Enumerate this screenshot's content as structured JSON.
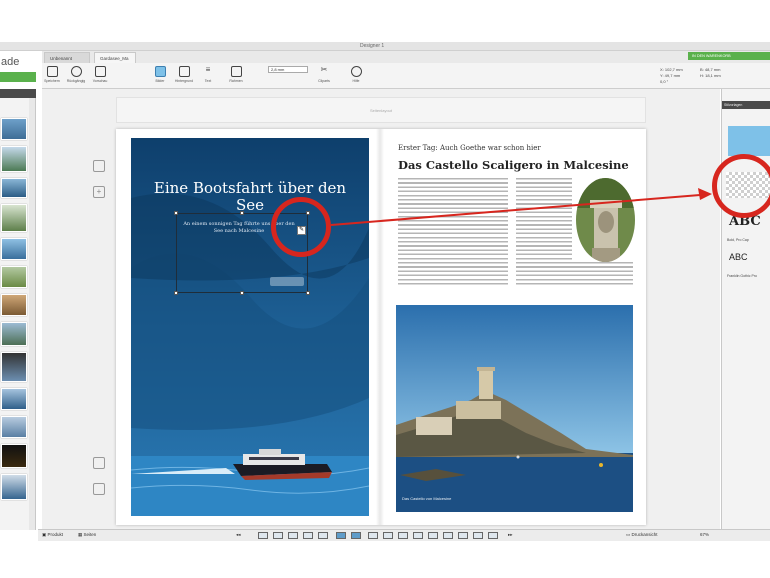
{
  "window": {
    "title": "Designer 1"
  },
  "logo": {
    "text": "ade"
  },
  "tabs": [
    {
      "label": "Unbenannt"
    },
    {
      "label": "Gardasee_Ma"
    }
  ],
  "toolbar": {
    "tools": [
      {
        "label": "Speichern",
        "icon": "save-icon"
      },
      {
        "label": "Rückgängig",
        "icon": "undo-icon"
      },
      {
        "label": "Vorschau",
        "icon": "preview-icon"
      },
      {
        "label": "Bilder",
        "icon": "image-icon"
      },
      {
        "label": "Hintergrund",
        "icon": "background-icon"
      },
      {
        "label": "Text",
        "icon": "text-icon"
      },
      {
        "label": "Rahmen",
        "icon": "frame-icon"
      },
      {
        "label": "Cliparts",
        "icon": "clipart-icon"
      },
      {
        "label": "Hilfe",
        "icon": "help-icon"
      }
    ],
    "font_size": "2,8 mm"
  },
  "coordinates": {
    "x": "X: 102,7 mm",
    "y": "Y: 49,7 mm",
    "w": "B: 48,7 mm",
    "h": "H: 18,1 mm",
    "angle": "0,0 °"
  },
  "order_button": "IN DEN WARENKORB",
  "layout_bar": "Seitenlayout",
  "left_page": {
    "headline": "Eine Bootsfahrt über den See",
    "subtitle": "An einem sonnigen Tag führte uns über den See nach Malcesine"
  },
  "right_page": {
    "kicker": "Erster Tag: Auch Goethe war schon hier",
    "headline": "Das Castello Scaligero in Malcesine",
    "caption": "Das Castello von Malcesine"
  },
  "right_panel": {
    "header": "Stilvorlagen",
    "styles": [
      {
        "sample": "ABC",
        "label": "Bold, Pro Cap"
      },
      {
        "sample": "ABC",
        "label": "Franklin Gothic Pro"
      }
    ]
  },
  "bottom": {
    "produkt": "Produkt",
    "seiten": "Seiten",
    "druckansicht": "Druckansicht",
    "zoom": "67%"
  },
  "colors": {
    "accent_green": "#5ab14c",
    "annotation_red": "#d7261e",
    "lake_blue": "#1f5a88"
  }
}
